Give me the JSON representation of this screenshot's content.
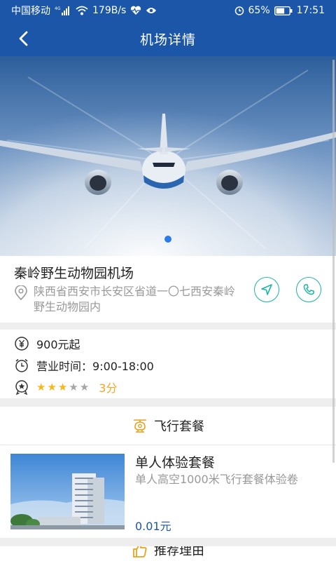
{
  "status_bar": {
    "carrier": "中国移动",
    "net_speed": "179B/s",
    "battery": "65%",
    "time": "17:51"
  },
  "header": {
    "title": "机场详情"
  },
  "banner": {
    "current_slide": 1,
    "slide_count": 1
  },
  "airport": {
    "name": "秦岭野生动物园机场",
    "address": "陕西省西安市长安区省道一〇七西安秦岭野生动物园内"
  },
  "details": {
    "price": "900元起",
    "hours_label": "营业时间：",
    "hours_value": "9:00-18:00",
    "rating_stars": 3,
    "rating_max": 5,
    "rating_text": "3分"
  },
  "sections": {
    "flight_packages": "飞行套餐",
    "recommended": "推荐理由"
  },
  "package": {
    "name": "单人体验套餐",
    "description": "单人高空1000米飞行套餐体验卷",
    "price": "0.01元"
  },
  "colors": {
    "primary": "#1b56a8",
    "teal": "#1bb6a5",
    "star": "#f5b81e",
    "price_accent": "#f5a623"
  }
}
